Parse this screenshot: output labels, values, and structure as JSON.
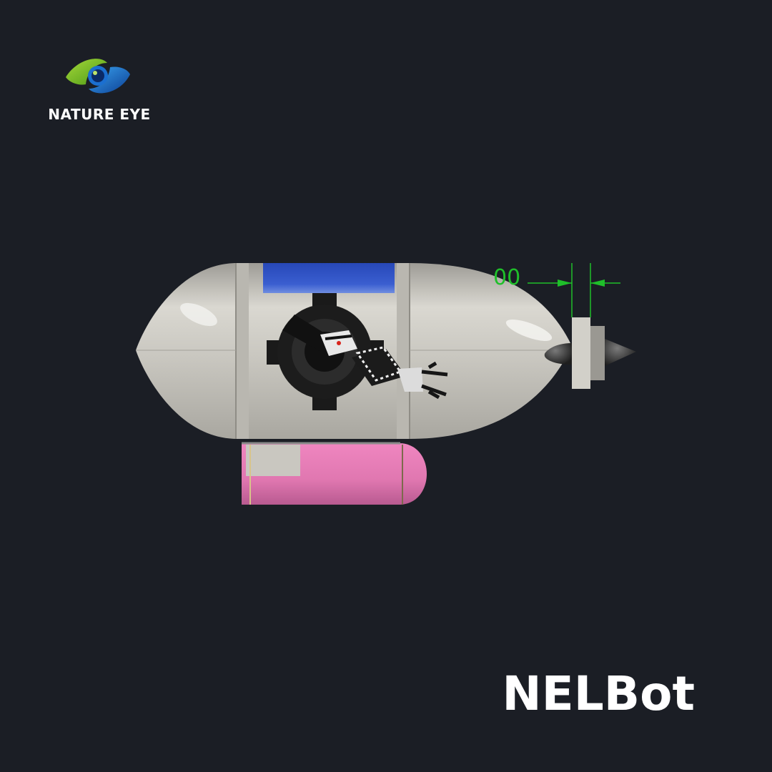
{
  "brand": {
    "name": "NATURE EYE",
    "logo_icon": "eye-logo-icon",
    "colors": {
      "green": "#7cc324",
      "blue": "#1e88e5",
      "dark_blue": "#0d3a8a"
    }
  },
  "product": {
    "title": "NELBot",
    "dimension_label": "00"
  },
  "colors": {
    "background": "#1b1e25",
    "hull": "#c9c7c0",
    "top_panel": "#2d52c4",
    "battery": "#e27ab3",
    "dimension": "#1fbf2a"
  }
}
